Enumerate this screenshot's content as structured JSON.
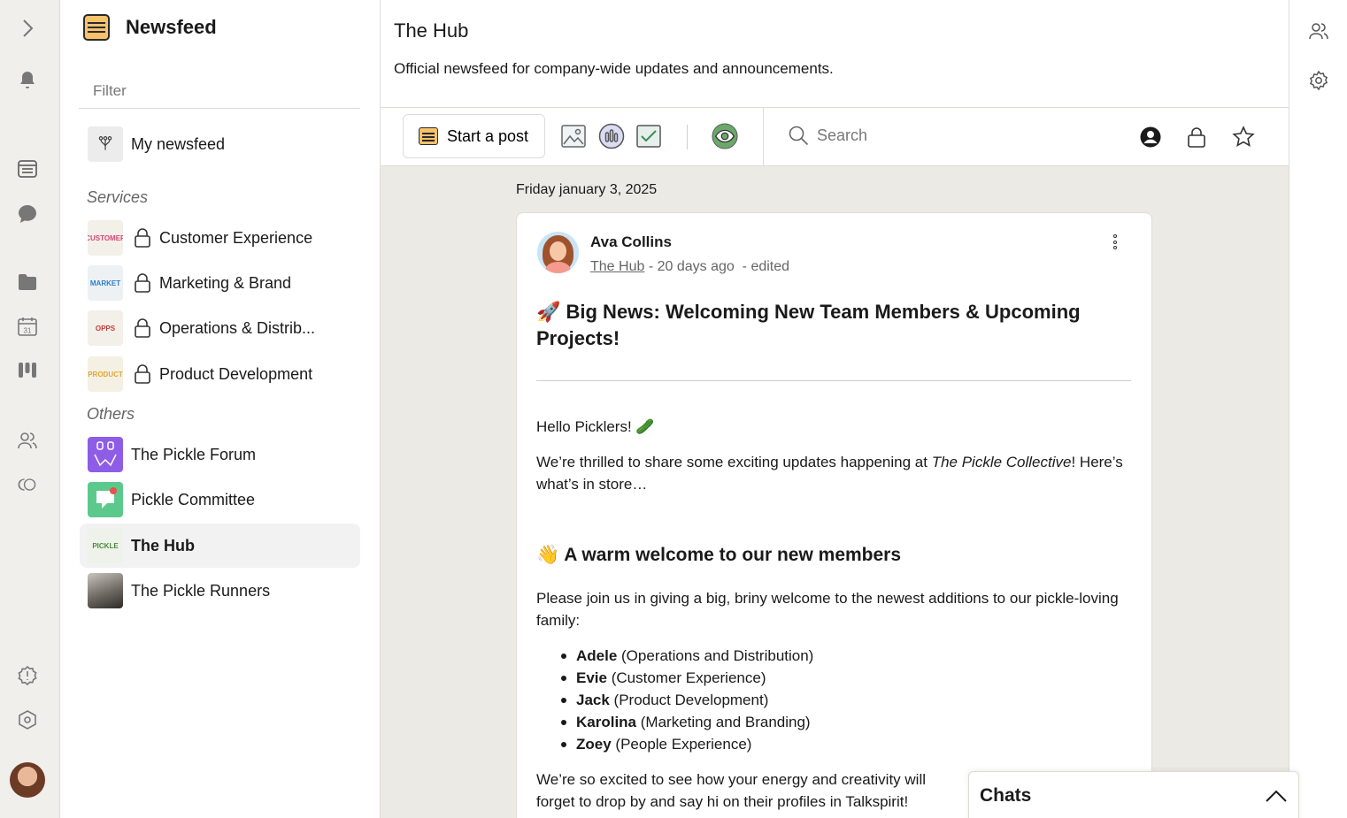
{
  "rail": {
    "items": [
      {
        "name": "expand-chevron-icon"
      },
      {
        "name": "bell-icon"
      },
      {
        "name": "newsfeed-icon"
      },
      {
        "name": "chat-bubble-icon"
      },
      {
        "name": "folder-icon"
      },
      {
        "name": "calendar-icon",
        "day": "31"
      },
      {
        "name": "kanban-icon"
      },
      {
        "name": "people-icon"
      },
      {
        "name": "spaces-icon"
      },
      {
        "name": "alert-icon"
      },
      {
        "name": "hexagon-settings-icon"
      }
    ]
  },
  "sidebar": {
    "title": "Newsfeed",
    "filter_placeholder": "Filter",
    "my_newsfeed": "My newsfeed",
    "services_heading": "Services",
    "others_heading": "Others",
    "services": [
      {
        "label": "Customer Experience",
        "thumb_text": "CUSTOMER",
        "thumb_color": "#d2487a"
      },
      {
        "label": "Marketing & Brand",
        "thumb_text": "MARKET",
        "thumb_color": "#2a7fc9"
      },
      {
        "label": "Operations & Distrib...",
        "thumb_text": "OPPS",
        "thumb_color": "#c83b3b"
      },
      {
        "label": "Product Development",
        "thumb_text": "PRODUCT",
        "thumb_color": "#e0a82e"
      }
    ],
    "others": [
      {
        "label": "The Pickle Forum"
      },
      {
        "label": "Pickle Committee"
      },
      {
        "label": "The Hub",
        "thumb_text": "PICKLE",
        "active": true
      },
      {
        "label": "The Pickle Runners"
      }
    ]
  },
  "header": {
    "title": "The Hub",
    "description": "Official newsfeed for company-wide updates and announcements."
  },
  "toolbar": {
    "start_post": "Start a post",
    "search_placeholder": "Search"
  },
  "feed": {
    "date": "Friday january 3, 2025",
    "post": {
      "author": "Ava Collins",
      "channel": "The Hub",
      "separator": " - ",
      "time": "20 days ago",
      "edited": "- edited",
      "title": "🚀 Big News: Welcoming New Team Members & Upcoming Projects!",
      "greeting": "Hello Picklers! 🥒",
      "intro_1": "We’re thrilled to share some exciting updates happening at ",
      "intro_em": "The Pickle Collective",
      "intro_2": "! Here’s what’s in store…",
      "section_heading": "👋 A warm welcome to our new members",
      "welcome_text": "Please join us in giving a big, briny welcome to the newest additions to our pickle-loving family:",
      "members": [
        {
          "name": "Adele",
          "team": " (Operations and Distribution)"
        },
        {
          "name": "Evie",
          "team": " (Customer Experience)"
        },
        {
          "name": "Jack",
          "team": " (Product Development)"
        },
        {
          "name": "Karolina",
          "team": " (Marketing and Branding)"
        },
        {
          "name": "Zoey",
          "team": " (People Experience)"
        }
      ],
      "closing_1": "We’re so excited to see how your energy and creativity will",
      "closing_2": "forget to drop by and say hi on their profiles in Talkspirit!"
    }
  },
  "chats": {
    "title": "Chats"
  },
  "colors": {
    "rail_bg": "#f0efeb",
    "feed_bg": "#eceae5",
    "accent_yellow": "#f7c26b",
    "visibility_green": "#6aa96a"
  }
}
